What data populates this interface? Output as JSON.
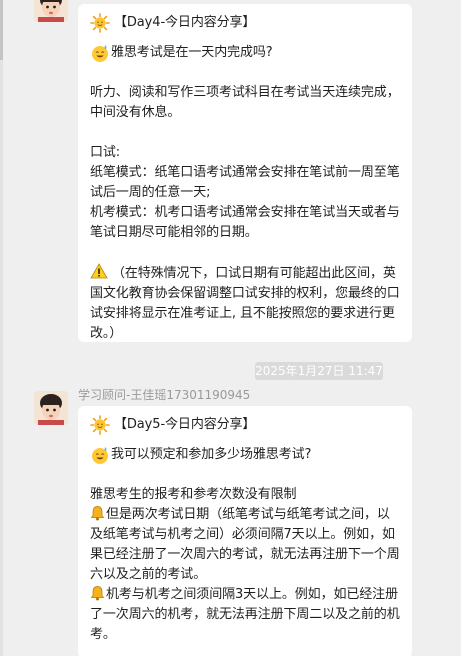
{
  "messages": [
    {
      "title": "【Day4-今日内容分享】",
      "question": "雅思考试是在一天内完成吗?",
      "answer_1": "听力、阅读和写作三项考试科目在考试当天连续完成，中间没有休息。",
      "oral_heading": "口试:",
      "oral_paper": "纸笔模式：纸笔口语考试通常会安排在笔试前一周至笔试后一周的任意一天;",
      "oral_computer": "机考模式：机考口语考试通常会安排在笔试当天或者与笔试日期尽可能相邻的日期。",
      "note": "（在特殊情况下，口试日期有可能超出此区间，英国文化教育协会保留调整口试安排的权利，您最终的口试安排将显示在准考证上, 且不能按照您的要求进行更改。）"
    },
    {
      "title": "【Day5-今日内容分享】",
      "question": "我可以预定和参加多少场雅思考试?",
      "answer_1": "雅思考生的报考和参考次数没有限制",
      "rule_1": "但是两次考试日期（纸笔考试与纸笔考试之间，以及纸笔考试与机考之间）必须间隔7天以上。例如，如果已经注册了一次周六的考试，就无法再注册下一个周六以及之前的考试。",
      "rule_2": "机考与机考之间须间隔3天以上。例如，如已经注册了一次周六的机考，就无法再注册下周二以及之前的机考。"
    }
  ],
  "timestamp": "2025年1月27日 11:47",
  "sender_name": "学习顾问-王佳瑶17301190945",
  "colors": {
    "background": "#efefef",
    "bubble": "#ffffff",
    "timestamp_bg": "#dadada",
    "sender": "#9a9a9a"
  },
  "icons": [
    "avatar",
    "sun-emoji-icon",
    "sweat-smile-emoji-icon",
    "warning-icon",
    "bell-icon"
  ]
}
